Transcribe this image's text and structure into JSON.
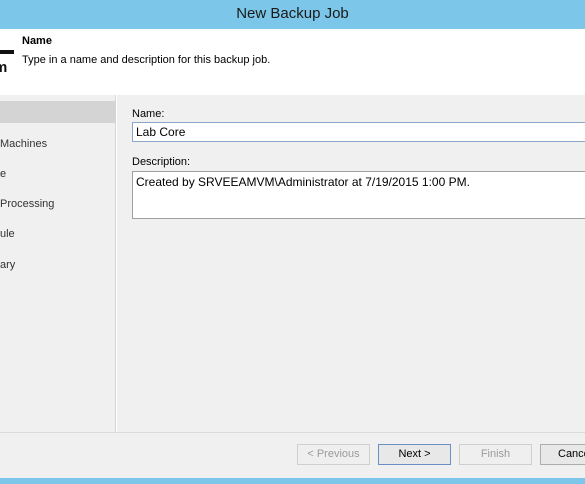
{
  "window": {
    "title": "New Backup Job"
  },
  "header": {
    "logo_text": "m",
    "title": "Name",
    "description": "Type in a name and description for this backup job."
  },
  "sidebar": {
    "steps": [
      {
        "label": "",
        "selected": true
      },
      {
        "label": "Machines",
        "selected": false
      },
      {
        "label": "e",
        "selected": false
      },
      {
        "label": "Processing",
        "selected": false
      },
      {
        "label": "ule",
        "selected": false
      },
      {
        "label": "ary",
        "selected": false
      }
    ]
  },
  "form": {
    "name_label": "Name:",
    "name_value": "Lab Core",
    "description_label": "Description:",
    "description_value": "Created by SRVEEAMVM\\Administrator at 7/19/2015 1:00 PM."
  },
  "footer": {
    "previous_label": "< Previous",
    "next_label": "Next >",
    "finish_label": "Finish",
    "cancel_label": "Cancel"
  },
  "colors": {
    "titlebar": "#7cc7e9",
    "panel": "#f0f0f0",
    "selected_step": "#d4d4d4"
  }
}
